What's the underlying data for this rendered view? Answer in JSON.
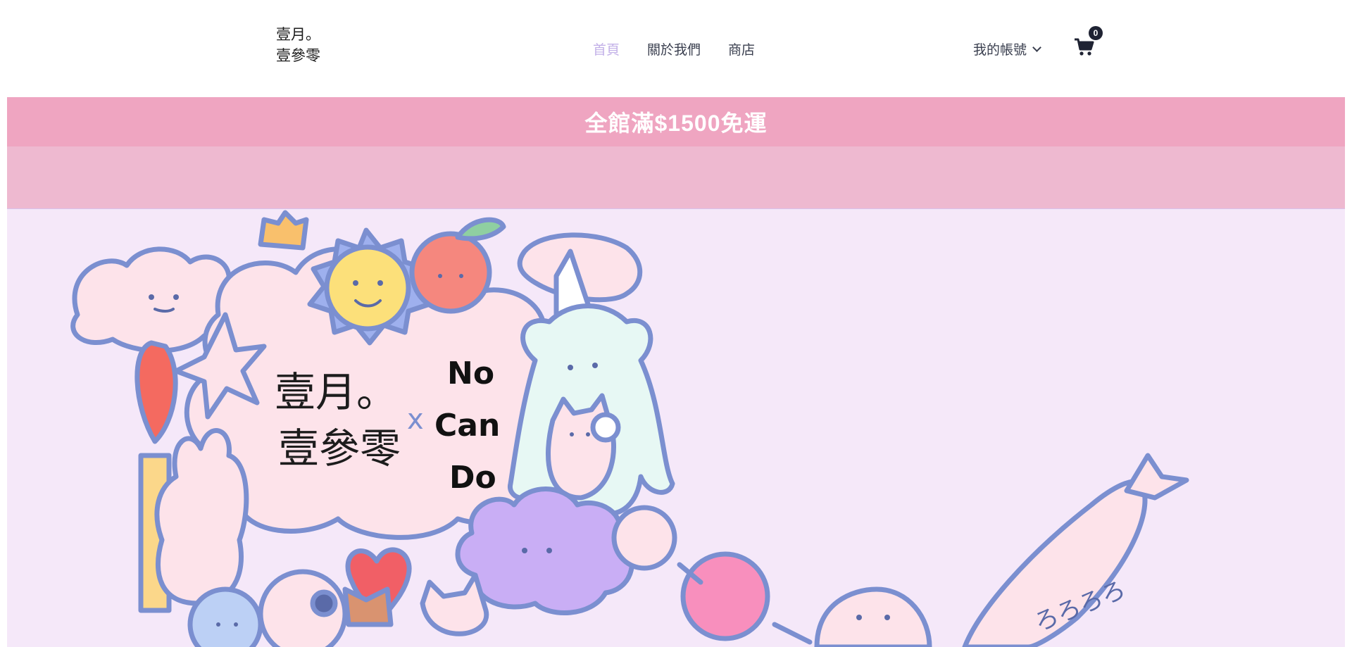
{
  "header": {
    "logo": {
      "line1": "壹月。",
      "line2": "壹參零"
    },
    "nav": [
      {
        "label": "首頁",
        "active": true
      },
      {
        "label": "關於我們",
        "active": false
      },
      {
        "label": "商店",
        "active": false
      }
    ],
    "account": {
      "label": "我的帳號"
    },
    "cart": {
      "count": "0",
      "icon": "cart-icon"
    }
  },
  "promo": {
    "text": "全館滿$1500免運"
  },
  "hero": {
    "artwork": {
      "brand_left_line1": "壹月。",
      "brand_left_line2": "壹參零",
      "separator": "x",
      "brand_right": [
        "No",
        "Can",
        "Do"
      ],
      "fish_text": "ろろろろ"
    }
  },
  "colors": {
    "accent": "#c3b1e8",
    "promo_bg": "#efa5c1",
    "promo_sub_bg": "#eeb9d0",
    "hero_bg": "#f5e8f9",
    "outline": "#7b8fd0"
  }
}
